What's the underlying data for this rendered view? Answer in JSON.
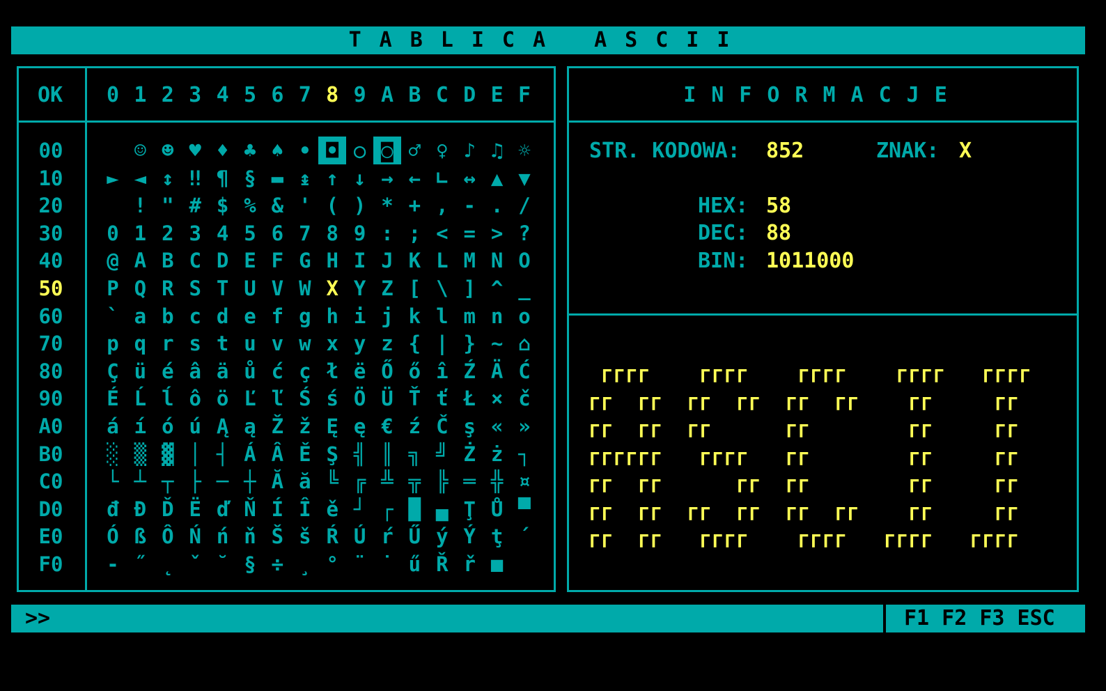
{
  "title": "TABLICA ASCII",
  "grid": {
    "corner_label": "OK",
    "columns": [
      "0",
      "1",
      "2",
      "3",
      "4",
      "5",
      "6",
      "7",
      "8",
      "9",
      "A",
      "B",
      "C",
      "D",
      "E",
      "F"
    ],
    "selected_col": 8,
    "selected_row": 5,
    "rows": [
      {
        "label": "00",
        "chars": [
          " ",
          "☺",
          "☻",
          "♥",
          "♦",
          "♣",
          "♠",
          "•",
          "◘",
          "○",
          "◙",
          "♂",
          "♀",
          "♪",
          "♫",
          "☼"
        ]
      },
      {
        "label": "10",
        "chars": [
          "►",
          "◄",
          "↕",
          "‼",
          "¶",
          "§",
          "▬",
          "↨",
          "↑",
          "↓",
          "→",
          "←",
          "∟",
          "↔",
          "▲",
          "▼"
        ]
      },
      {
        "label": "20",
        "chars": [
          " ",
          "!",
          "\"",
          "#",
          "$",
          "%",
          "&",
          "'",
          "(",
          ")",
          "*",
          "+",
          ",",
          "-",
          ".",
          "/"
        ]
      },
      {
        "label": "30",
        "chars": [
          "0",
          "1",
          "2",
          "3",
          "4",
          "5",
          "6",
          "7",
          "8",
          "9",
          ":",
          ";",
          "<",
          "=",
          ">",
          "?"
        ]
      },
      {
        "label": "40",
        "chars": [
          "@",
          "A",
          "B",
          "C",
          "D",
          "E",
          "F",
          "G",
          "H",
          "I",
          "J",
          "K",
          "L",
          "M",
          "N",
          "O"
        ]
      },
      {
        "label": "50",
        "chars": [
          "P",
          "Q",
          "R",
          "S",
          "T",
          "U",
          "V",
          "W",
          "X",
          "Y",
          "Z",
          "[",
          "\\",
          "]",
          "^",
          "_"
        ]
      },
      {
        "label": "60",
        "chars": [
          "`",
          "a",
          "b",
          "c",
          "d",
          "e",
          "f",
          "g",
          "h",
          "i",
          "j",
          "k",
          "l",
          "m",
          "n",
          "o"
        ]
      },
      {
        "label": "70",
        "chars": [
          "p",
          "q",
          "r",
          "s",
          "t",
          "u",
          "v",
          "w",
          "x",
          "y",
          "z",
          "{",
          "|",
          "}",
          "~",
          "⌂"
        ]
      },
      {
        "label": "80",
        "chars": [
          "Ç",
          "ü",
          "é",
          "â",
          "ä",
          "ů",
          "ć",
          "ç",
          "ł",
          "ë",
          "Ő",
          "ő",
          "î",
          "Ź",
          "Ä",
          "Ć"
        ]
      },
      {
        "label": "90",
        "chars": [
          "É",
          "Ĺ",
          "ĺ",
          "ô",
          "ö",
          "Ľ",
          "ľ",
          "Ś",
          "ś",
          "Ö",
          "Ü",
          "Ť",
          "ť",
          "Ł",
          "×",
          "č"
        ]
      },
      {
        "label": "A0",
        "chars": [
          "á",
          "í",
          "ó",
          "ú",
          "Ą",
          "ą",
          "Ž",
          "ž",
          "Ę",
          "ę",
          "€",
          "ź",
          "Č",
          "ş",
          "«",
          "»"
        ]
      },
      {
        "label": "B0",
        "chars": [
          "░",
          "▒",
          "▓",
          "│",
          "┤",
          "Á",
          "Â",
          "Ě",
          "Ş",
          "╣",
          "║",
          "╗",
          "╝",
          "Ż",
          "ż",
          "┐"
        ]
      },
      {
        "label": "C0",
        "chars": [
          "└",
          "┴",
          "┬",
          "├",
          "─",
          "┼",
          "Ă",
          "ă",
          "╚",
          "╔",
          "╩",
          "╦",
          "╠",
          "═",
          "╬",
          "¤"
        ]
      },
      {
        "label": "D0",
        "chars": [
          "đ",
          "Đ",
          "Ď",
          "Ë",
          "ď",
          "Ň",
          "Í",
          "Î",
          "ě",
          "┘",
          "┌",
          "█",
          "▄",
          "Ţ",
          "Ů",
          "▀"
        ]
      },
      {
        "label": "E0",
        "chars": [
          "Ó",
          "ß",
          "Ô",
          "Ń",
          "ń",
          "ň",
          "Š",
          "š",
          "Ŕ",
          "Ú",
          "ŕ",
          "Ű",
          "ý",
          "Ý",
          "ţ",
          "´"
        ]
      },
      {
        "label": "F0",
        "chars": [
          "-",
          "˝",
          "˛",
          "ˇ",
          "˘",
          "§",
          "÷",
          "¸",
          "°",
          "¨",
          "˙",
          "ű",
          "Ř",
          "ř",
          "■",
          " "
        ]
      }
    ]
  },
  "info": {
    "title": "INFORMACJE",
    "codepage_label": "STR. KODOWA:",
    "codepage_value": "852",
    "char_label": "ZNAK:",
    "char_value": "X",
    "hex_label": "HEX:",
    "hex_value": "58",
    "dec_label": "DEC:",
    "dec_value": "88",
    "bin_label": "BIN:",
    "bin_value": "1011000",
    "big_glyph": " ▔▔▔▔   ▔▔▔▔   ▔▔▔▔   ▔▔▔▔  ▔▔▔▔"
  },
  "status": {
    "prompt": ">>",
    "keys": "F1 F2 F3 ESC"
  },
  "colors": {
    "background": "#000000",
    "cyan": "#00aaaa",
    "yellow": "#ffff55"
  }
}
